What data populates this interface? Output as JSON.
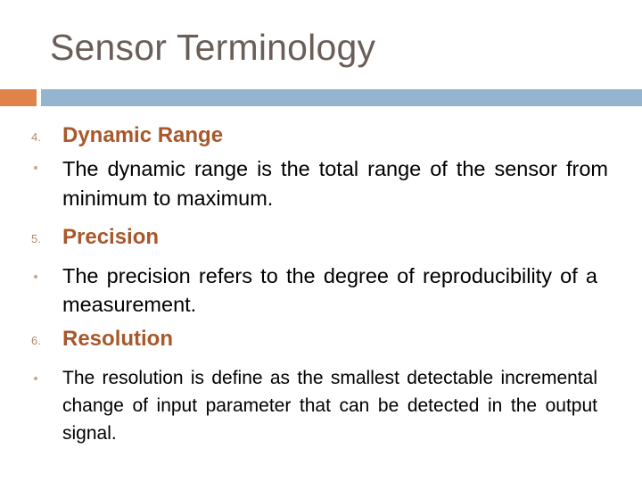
{
  "slide": {
    "title": "Sensor Terminology",
    "colors": {
      "title": "#6b5e58",
      "heading": "#a8582b",
      "accent_bar": "#e0834a",
      "main_bar": "#94b4d0",
      "body_text": "#000000"
    },
    "items": [
      {
        "number": "4.",
        "heading": "Dynamic Range",
        "bullet": "•",
        "text": "The dynamic range is the total range of the sensor from minimum to maximum."
      },
      {
        "number": "5.",
        "heading": "Precision",
        "bullet": "•",
        "text": "The precision refers to the degree of reproducibility of a measurement."
      },
      {
        "number": "6.",
        "heading": "Resolution",
        "bullet": "•",
        "text": "The resolution is define as the smallest detectable incremental change of input parameter that can be detected in the output signal."
      }
    ]
  }
}
